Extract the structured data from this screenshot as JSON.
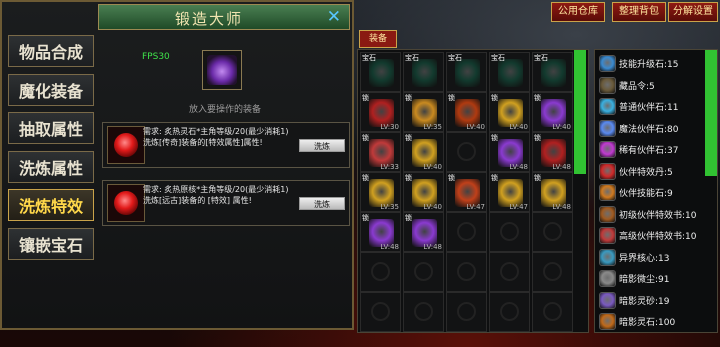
{
  "title": "锻造大师",
  "tabs": [
    "物品合成",
    "魔化装备",
    "抽取属性",
    "洗炼属性",
    "洗炼特效",
    "镶嵌宝石"
  ],
  "active_tab": 4,
  "fps": "FPS30",
  "slot_hint": "放入要操作的装备",
  "recipes": [
    {
      "line1": "需求: 炙热灵石*主角等级/20(最少消耗1)",
      "line2": "洗炼[传奇]装备的[特效属性]属性!",
      "button": "洗炼"
    },
    {
      "line1": "需求: 炙热原核*主角等级/20(最少消耗1)",
      "line2": "洗炼[远古]装备的 [特效] 属性!",
      "button": "洗炼"
    }
  ],
  "top_buttons": [
    "公用仓库",
    "整理背包",
    "分解设置"
  ],
  "inventory_tab": "装备",
  "inventory": [
    {
      "tag": "宝石",
      "lv": "",
      "color": "#123a2e"
    },
    {
      "tag": "宝石",
      "lv": "",
      "color": "#123a2e"
    },
    {
      "tag": "宝石",
      "lv": "",
      "color": "#123a2e"
    },
    {
      "tag": "宝石",
      "lv": "",
      "color": "#123a2e"
    },
    {
      "tag": "宝石",
      "lv": "",
      "color": "#123a2e"
    },
    {
      "tag": "锁",
      "lv": "LV:30",
      "color": "#b02020"
    },
    {
      "tag": "锁",
      "lv": "LV:35",
      "color": "#c98a20"
    },
    {
      "tag": "锁",
      "lv": "LV:40",
      "color": "#b03a10"
    },
    {
      "tag": "锁",
      "lv": "LV:40",
      "color": "#d0a020"
    },
    {
      "tag": "锁",
      "lv": "LV:40",
      "color": "#8a3ad0"
    },
    {
      "tag": "锁",
      "lv": "LV:33",
      "color": "#c03a3a"
    },
    {
      "tag": "锁",
      "lv": "LV:40",
      "color": "#d0a020"
    },
    {
      "tag": "",
      "lv": "",
      "color": ""
    },
    {
      "tag": "锁",
      "lv": "LV:48",
      "color": "#8a3ad0"
    },
    {
      "tag": "锁",
      "lv": "LV:48",
      "color": "#b02020"
    },
    {
      "tag": "锁",
      "lv": "LV:35",
      "color": "#d0a020"
    },
    {
      "tag": "锁",
      "lv": "LV:40",
      "color": "#d0a020"
    },
    {
      "tag": "锁",
      "lv": "LV:47",
      "color": "#c0401a"
    },
    {
      "tag": "锁",
      "lv": "LV:47",
      "color": "#d0a020"
    },
    {
      "tag": "锁",
      "lv": "LV:48",
      "color": "#d0a020"
    },
    {
      "tag": "锁",
      "lv": "LV:48",
      "color": "#8a3ad0"
    },
    {
      "tag": "锁",
      "lv": "LV:48",
      "color": "#8a3ad0"
    },
    {
      "tag": "",
      "lv": "",
      "color": ""
    },
    {
      "tag": "",
      "lv": "",
      "color": ""
    },
    {
      "tag": "",
      "lv": "",
      "color": ""
    },
    {
      "tag": "",
      "lv": "",
      "color": ""
    },
    {
      "tag": "",
      "lv": "",
      "color": ""
    },
    {
      "tag": "",
      "lv": "",
      "color": ""
    },
    {
      "tag": "",
      "lv": "",
      "color": ""
    },
    {
      "tag": "",
      "lv": "",
      "color": ""
    },
    {
      "tag": "",
      "lv": "",
      "color": ""
    },
    {
      "tag": "",
      "lv": "",
      "color": ""
    },
    {
      "tag": "",
      "lv": "",
      "color": ""
    },
    {
      "tag": "",
      "lv": "",
      "color": ""
    },
    {
      "tag": "",
      "lv": "",
      "color": ""
    }
  ],
  "materials": [
    {
      "text": "技能升级石:15",
      "color": "#3a8ad0"
    },
    {
      "text": "藏品令:5",
      "color": "#6a5a3a"
    },
    {
      "text": "普通伙伴石:11",
      "color": "#3ab0e0"
    },
    {
      "text": "魔法伙伴石:80",
      "color": "#5a8af0"
    },
    {
      "text": "稀有伙伴石:37",
      "color": "#c03ad0"
    },
    {
      "text": "伙伴特效丹:5",
      "color": "#d02a2a"
    },
    {
      "text": "伙伴技能石:9",
      "color": "#d07a20"
    },
    {
      "text": "初级伙伴特效书:10",
      "color": "#a05a20"
    },
    {
      "text": "高级伙伴特效书:10",
      "color": "#c03a3a"
    },
    {
      "text": "异界核心:13",
      "color": "#3a9ac0"
    },
    {
      "text": "暗影微尘:91",
      "color": "#8a8a8a"
    },
    {
      "text": "暗影灵砂:19",
      "color": "#7a5ac0"
    },
    {
      "text": "暗影灵石:100",
      "color": "#c06a1a"
    }
  ]
}
